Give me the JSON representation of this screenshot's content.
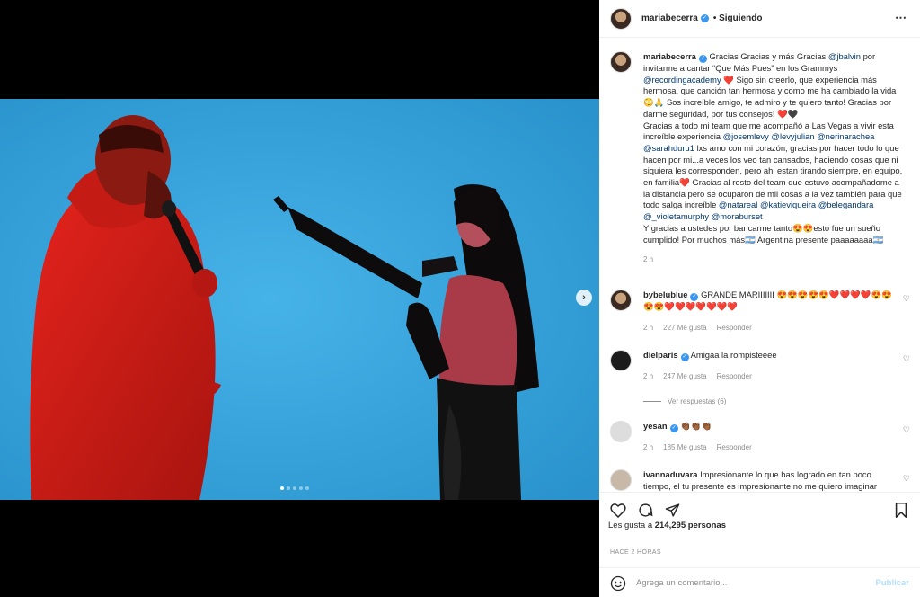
{
  "post": {
    "username": "mariabecerra",
    "follow_status": "• Siguiendo",
    "more_icon": "⋯"
  },
  "caption": {
    "username": "mariabecerra",
    "p1": "Gracias Gracias y más Gracias",
    "m1": "@jbalvin",
    "p2": "por invitarme a cantar “Que Más Pues” en los Grammys",
    "m2": "@recordingacademy",
    "p3": "❤️ Sigo sin creerlo, que experiencia más hermosa, que canción tan hermosa y como me ha cambiado la vida 😳🙏 Sos increíble amigo, te admiro y te quiero tanto! Gracias por darme seguridad, por tus consejos! ❤️🖤",
    "p4": "Gracias a todo mi team que me acompañó a Las Vegas a vivir esta increíble experiencia",
    "m3": "@josemlevy",
    "m4": "@levyjulian",
    "m5": "@nerinarachea",
    "m6": "@sarahduru1",
    "p5": "lxs amo con mi corazón, gracias por hacer todo lo que hacen por mi...a veces los veo tan cansados, haciendo cosas que ni siquiera les corresponden, pero ahi estan tirando siempre, en equipo, en familia❤️ Gracias al resto del team que estuvo acompañadome a la distancia pero se ocuparon de mil cosas a la vez también para que todo salga increíble",
    "m7": "@natareal",
    "m8": "@katieviqueira",
    "m9": "@belegandara",
    "m10": "@_violetamurphy",
    "m11": "@moraburset",
    "p6": "Y gracias a ustedes por bancarme tanto😍😍esto fue un sueño cumplido! Por muchos más🇦🇷 Argentina presente paaaaaaaa🇦🇷",
    "time": "2 h"
  },
  "comments": [
    {
      "username": "bybelublue",
      "text": "GRANDE MARIIIIIII 😍😍😍😍😍❤️❤️❤️❤️😍😍😍😍❤️❤️❤️❤️❤️❤️❤️",
      "time": "2 h",
      "likes": "227 Me gusta",
      "reply": "Responder"
    },
    {
      "username": "dielparis",
      "text": "Amigaa la rompisteeee",
      "time": "2 h",
      "likes": "247 Me gusta",
      "reply": "Responder",
      "replies": "Ver respuestas (6)"
    },
    {
      "username": "yesan",
      "text": "👏🏾👏🏾👏🏾",
      "time": "2 h",
      "likes": "185 Me gusta",
      "reply": "Responder"
    },
    {
      "username": "ivannaduvara",
      "text": "Impresionante lo que has logrado en tan poco tiempo, el tu presente es impresionante no me quiero imaginar",
      "time": "",
      "likes": "",
      "reply": ""
    }
  ],
  "likes": {
    "prefix": "Les gusta a",
    "count": "214,295 personas"
  },
  "time_ago": "HACE 2 HORAS",
  "add_comment": {
    "placeholder": "Agrega un comentario...",
    "post_label": "Publicar"
  },
  "carousel": {
    "total": 5,
    "active": 1,
    "next_glyph": "›"
  },
  "colors": {
    "stage_blue": "#2d9fd9",
    "link_blue": "#00376b",
    "verified_blue": "#3897f0",
    "post_button": "#b2dffc"
  }
}
